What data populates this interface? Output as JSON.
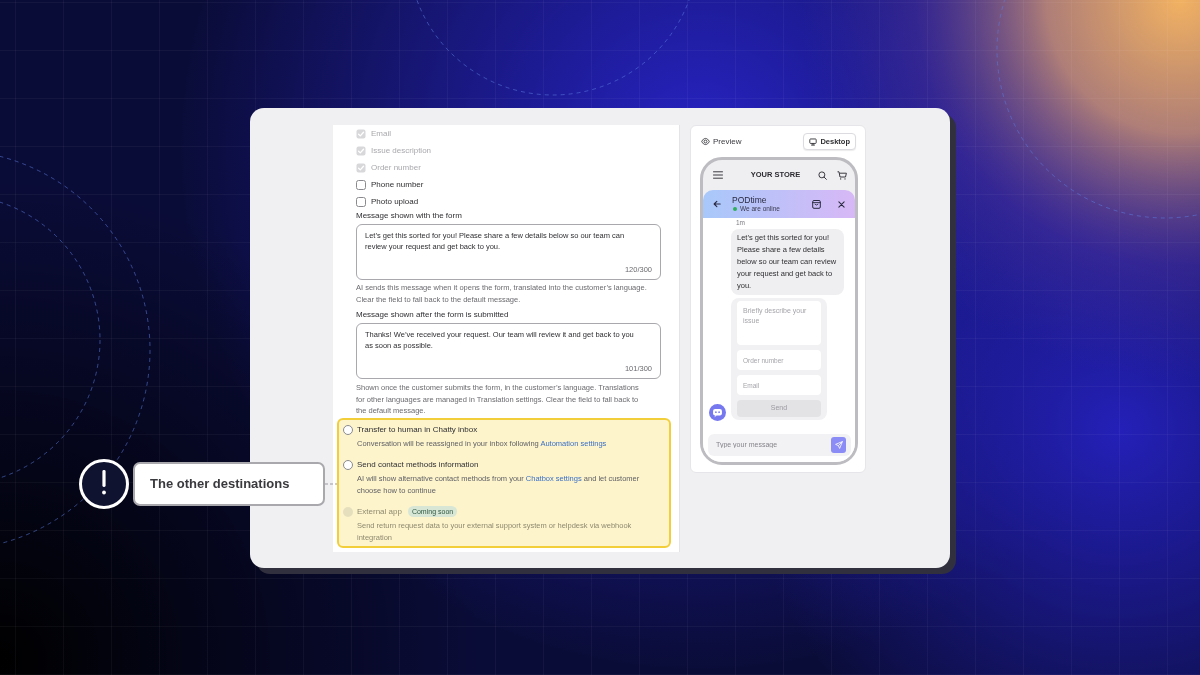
{
  "callout": {
    "text": "The other destinations"
  },
  "form": {
    "fields": [
      {
        "label": "Email",
        "checked": true,
        "disabled": true
      },
      {
        "label": "Issue description",
        "checked": true,
        "disabled": true
      },
      {
        "label": "Order number",
        "checked": true,
        "disabled": true
      },
      {
        "label": "Phone number",
        "checked": false,
        "disabled": false
      },
      {
        "label": "Photo upload",
        "checked": false,
        "disabled": false
      }
    ],
    "messages": [
      {
        "label": "Message shown with the form",
        "value": "Let’s get this sorted for you! Please share a few details below so our team can review your request and get back to you.",
        "count": "120/300",
        "help": "AI sends this message when it opens the form, translated into the customer’s language. Clear the field to fall back to the default message."
      },
      {
        "label": "Message shown after the form is submitted",
        "value": "Thanks! We’ve received your request. Our team will review it and get back to you as soon as possible.",
        "count": "101/300",
        "help": "Shown once the customer submits the form, in the customer’s language. Translations for other languages are managed in Translation settings. Clear the field to fall back to the default message."
      }
    ],
    "destinations": [
      {
        "title": "Transfer to human in Chatty inbox",
        "description": [
          {
            "kind": "text",
            "text": "Conversation will be reassigned in your inbox following "
          },
          {
            "kind": "link",
            "text": "Automation settings"
          }
        ],
        "selected": false,
        "disabled": false
      },
      {
        "title": "Send contact methods information",
        "description": [
          {
            "kind": "text",
            "text": "AI will show alternative contact methods from your "
          },
          {
            "kind": "link",
            "text": "Chatbox settings"
          },
          {
            "kind": "text",
            "text": " and let customer choose how to continue"
          }
        ],
        "selected": false,
        "disabled": false
      },
      {
        "title": "External app",
        "badge": "Coming soon",
        "description": [
          {
            "kind": "text",
            "text": "Send return request data to your external support system or helpdesk via webhook integration"
          }
        ],
        "selected": false,
        "disabled": true
      }
    ]
  },
  "preview": {
    "title": "Preview",
    "device": "Desktop",
    "store_name": "YOUR STORE",
    "chat": {
      "name": "PODtime",
      "status": "We are online",
      "online": true,
      "time": "1m",
      "message": "Let’s get this sorted for you! Please share a few details below so our team can review your request and get back to you.",
      "fields": [
        {
          "kind": "textarea",
          "placeholder": "Briefly describe your issue"
        },
        {
          "kind": "input",
          "placeholder": "Order number"
        },
        {
          "kind": "input",
          "placeholder": "Email"
        }
      ],
      "submit": {
        "label": "Send",
        "disabled": true
      },
      "input_placeholder": "Type your message"
    }
  }
}
